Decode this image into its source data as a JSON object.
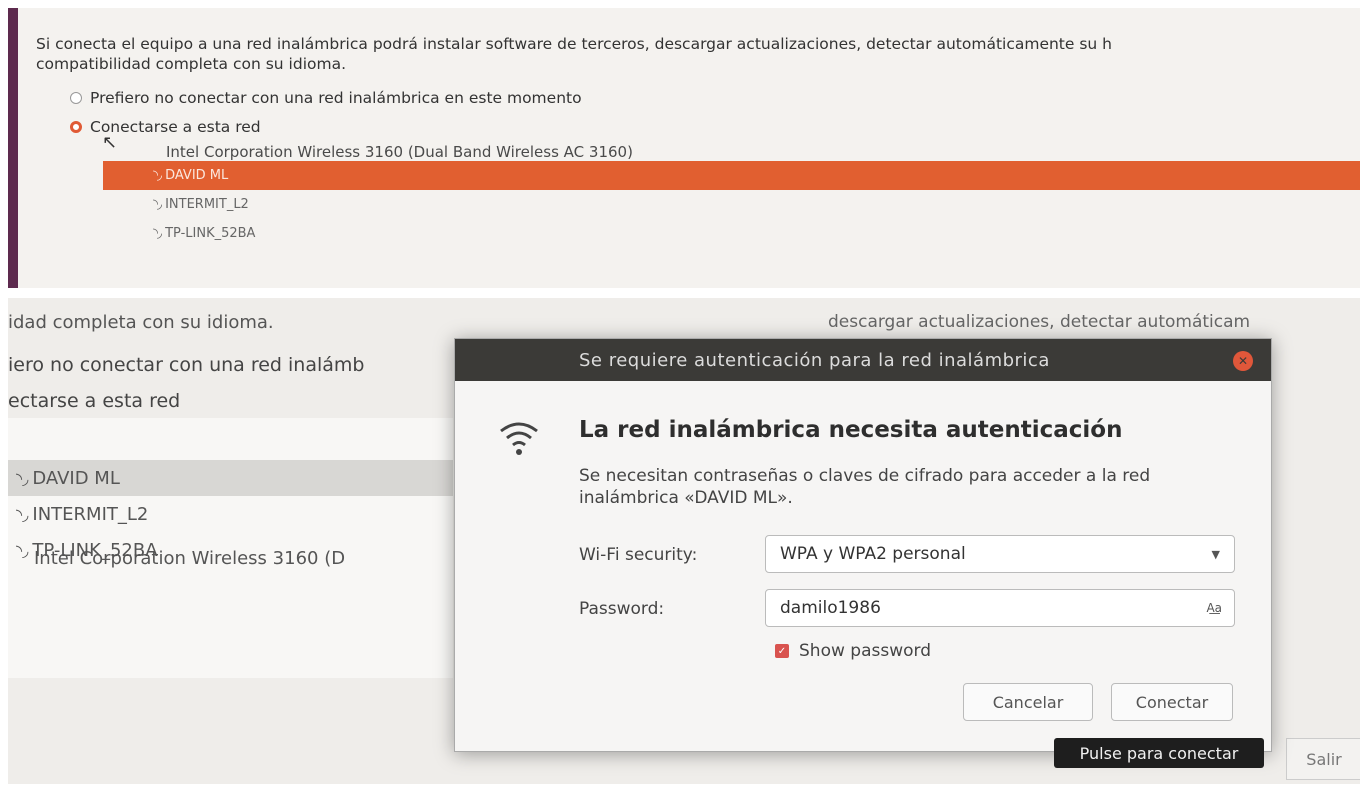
{
  "top": {
    "intro_line1": "Si conecta el equipo a una red inalámbrica podrá instalar software de terceros, descargar actualizaciones, detectar automáticamente su h",
    "intro_line2": "compatibilidad completa con su idioma.",
    "option_no_connect": "Prefiero no conectar con una red inalámbrica en este momento",
    "option_connect": "Conectarse a esta red",
    "adapter": "Intel Corporation Wireless 3160 (Dual Band Wireless AC 3160)",
    "networks": [
      "DAVID ML",
      "INTERMIT_L2",
      "TP-LINK_52BA"
    ],
    "selected_network": "DAVID ML"
  },
  "bottom": {
    "clip_line1": "idad completa con su idioma.",
    "clip_right": "descargar actualizaciones, detectar automáticam",
    "clip_option_no": "iero no conectar con una red inalámb",
    "clip_option_yes": "ectarse a esta red",
    "adapter_clipped": "Intel Corporation Wireless 3160 (D",
    "networks": [
      "DAVID ML",
      "INTERMIT_L2",
      "TP-LINK_52BA"
    ],
    "quit_button": "Salir"
  },
  "dialog": {
    "title": "Se requiere autenticación para la red inalámbrica",
    "heading": "La red inalámbrica necesita autenticación",
    "description": "Se necesitan contraseñas o claves de cifrado para acceder a la red inalámbrica «DAVID ML».",
    "security_label": "Wi-Fi security:",
    "security_value": "WPA y WPA2 personal",
    "password_label": "Password:",
    "password_value": "damilo1986",
    "show_password_label": "Show password",
    "cancel_button": "Cancelar",
    "connect_button": "Conectar",
    "tooltip": "Pulse para conectar"
  },
  "colors": {
    "accent": "#e15f30",
    "titlebar": "#3b3a37",
    "close": "#e0573a",
    "sidebar": "#5d2a4e"
  }
}
